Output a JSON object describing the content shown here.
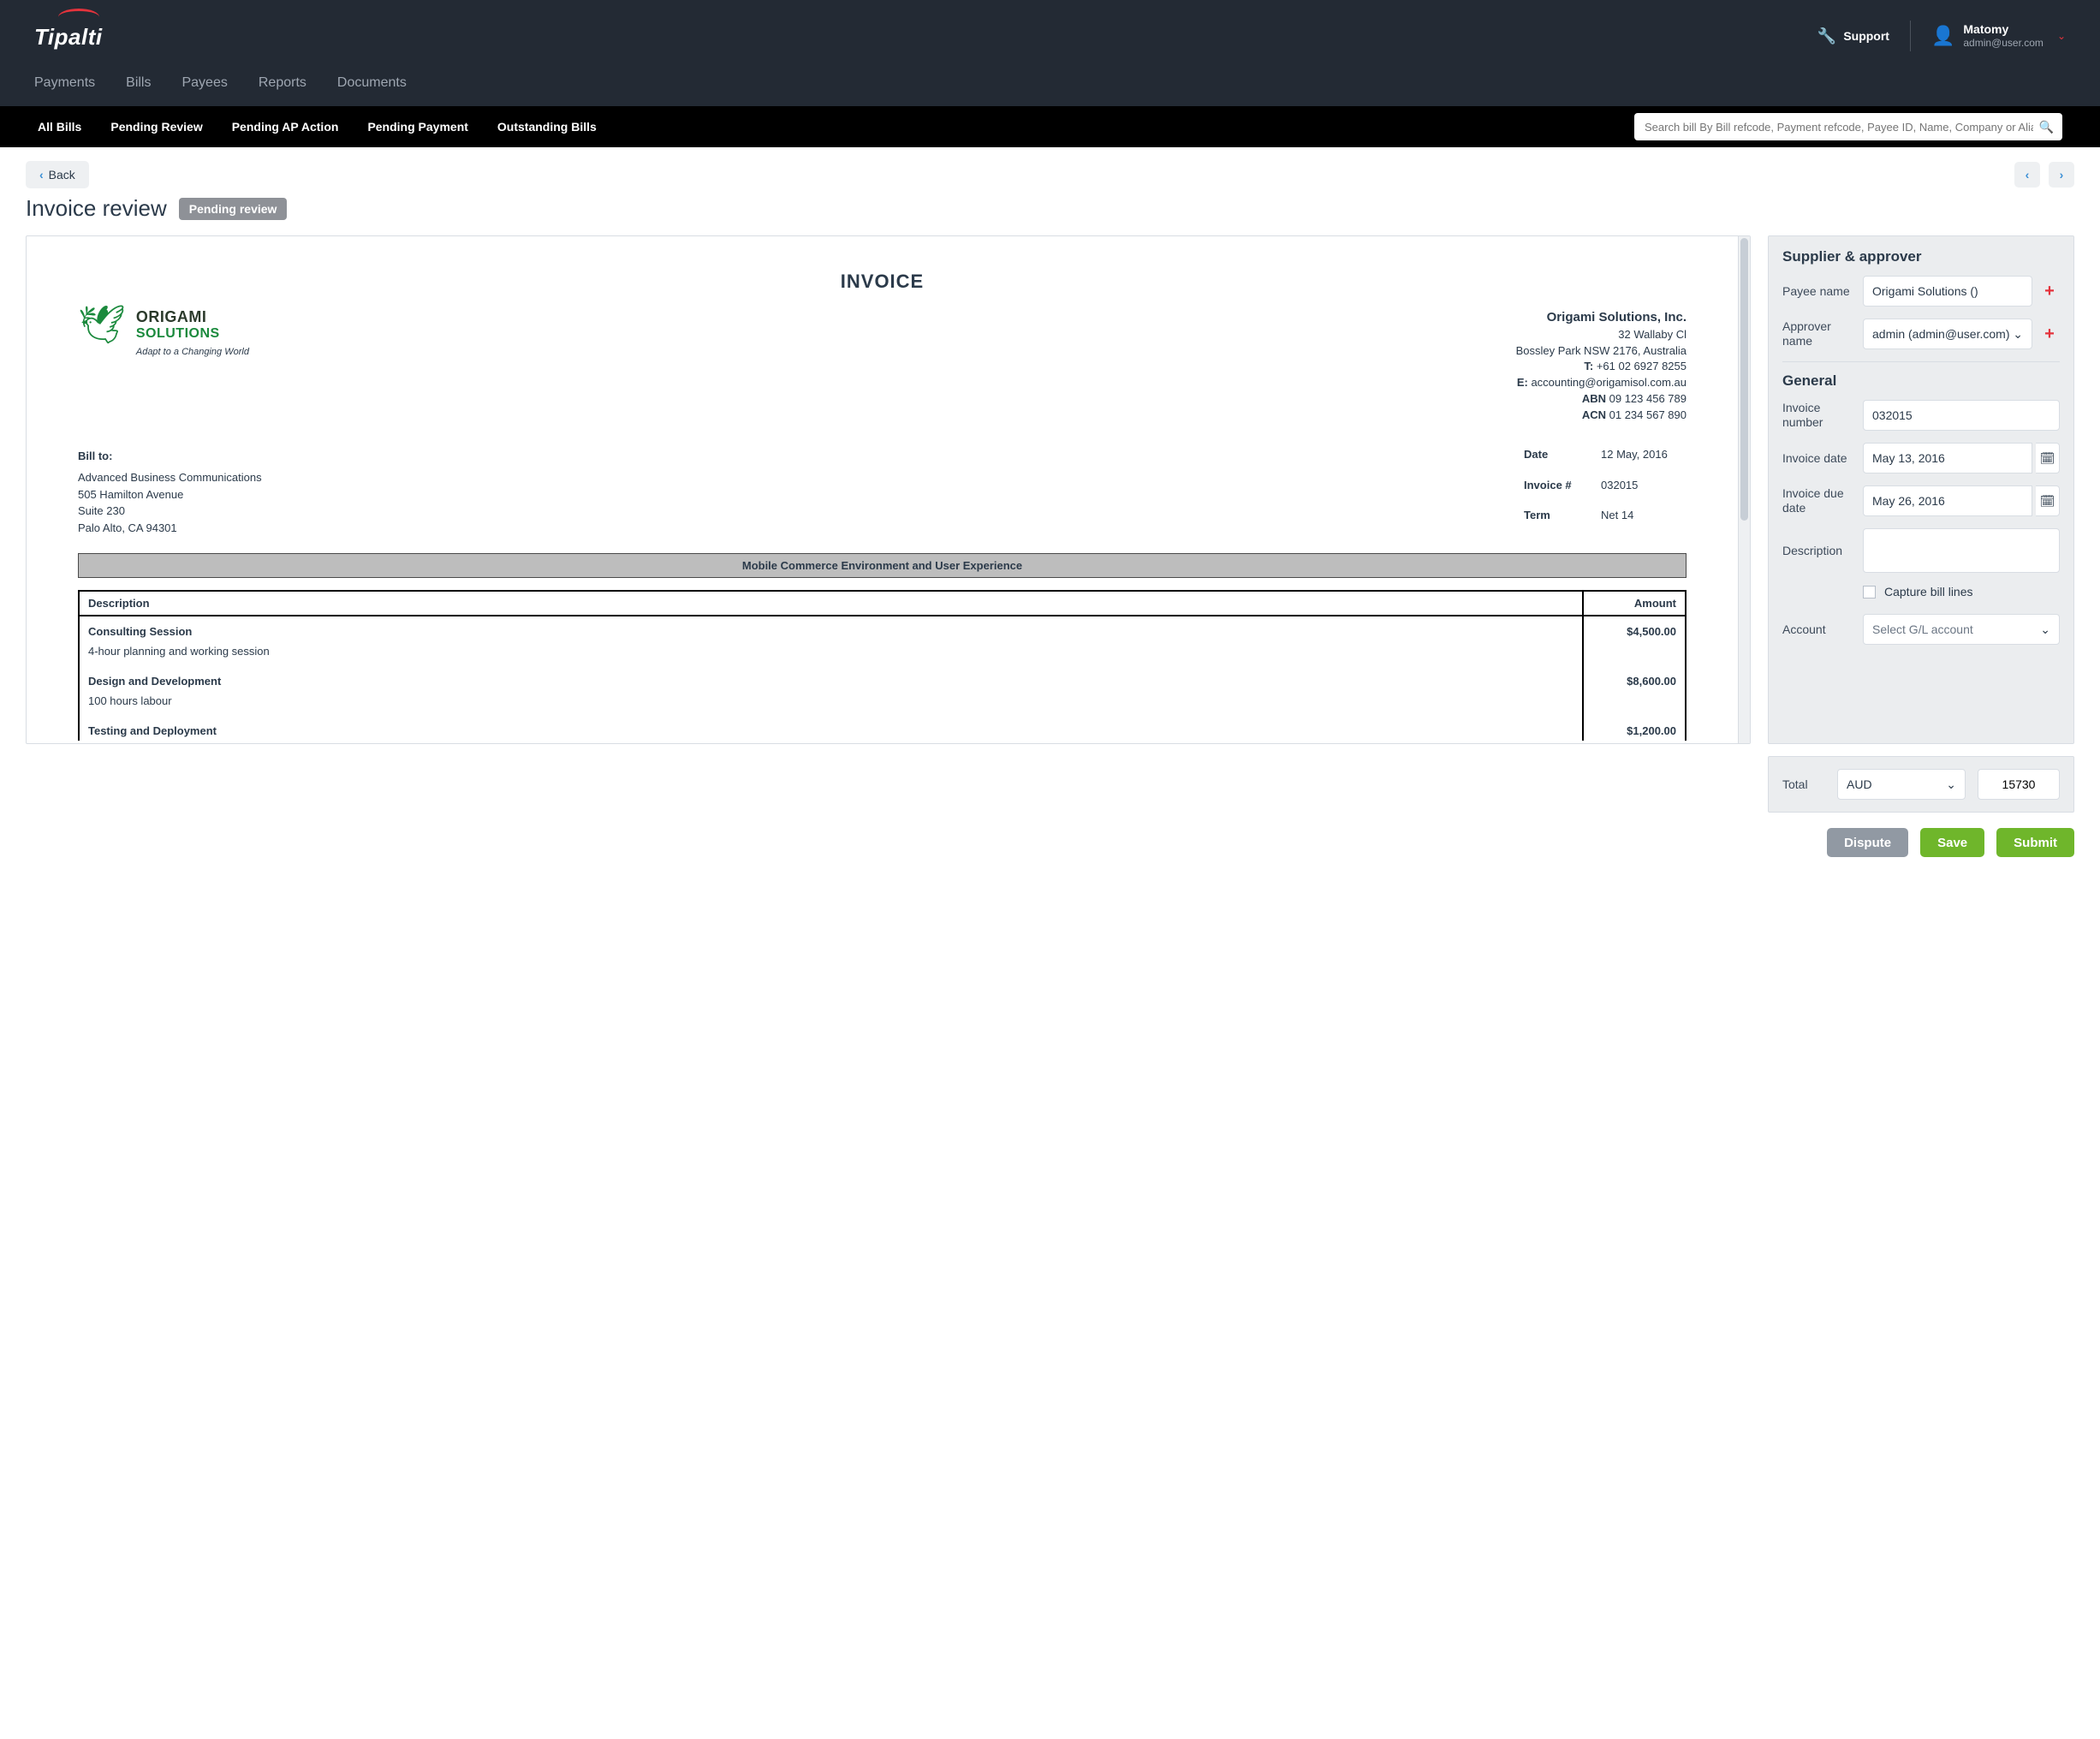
{
  "header": {
    "brand": "Tipalti",
    "support": "Support",
    "user_name": "Matomy",
    "user_email": "admin@user.com"
  },
  "nav1": [
    "Payments",
    "Bills",
    "Payees",
    "Reports",
    "Documents"
  ],
  "nav2": [
    "All Bills",
    "Pending Review",
    "Pending AP Action",
    "Pending Payment",
    "Outstanding Bills"
  ],
  "search_placeholder": "Search bill By Bill refcode, Payment refcode, Payee ID, Name, Company or Alias",
  "back": "Back",
  "page_title": "Invoice review",
  "status": "Pending review",
  "invoice_doc": {
    "title": "INVOICE",
    "company_upper": "ORIGAMI",
    "company_lower": "SOLUTIONS",
    "tagline": "Adapt to a Changing World",
    "company_full": "Origami Solutions, Inc.",
    "addr1": "32 Wallaby Cl",
    "addr2": "Bossley Park NSW 2176, Australia",
    "tel_label": "T:",
    "tel": "+61 02 6927 8255",
    "email_label": "E:",
    "email": "accounting@origamisol.com.au",
    "abn_label": "ABN",
    "abn": "09 123 456 789",
    "acn_label": "ACN",
    "acn": "01 234 567 890",
    "billto_label": "Bill to:",
    "billto": [
      "Advanced Business Communications",
      "505 Hamilton Avenue",
      "Suite 230",
      "Palo Alto, CA 94301"
    ],
    "meta": {
      "date_label": "Date",
      "date": "12 May, 2016",
      "num_label": "Invoice #",
      "num": "032015",
      "term_label": "Term",
      "term": "Net 14"
    },
    "project": "Mobile Commerce Environment and User Experience",
    "col_desc": "Description",
    "col_amt": "Amount",
    "items": [
      {
        "title": "Consulting Session",
        "sub": "4-hour planning and working session",
        "amount": "$4,500.00"
      },
      {
        "title": "Design and Development",
        "sub": "100 hours labour",
        "amount": "$8,600.00"
      },
      {
        "title": "Testing and Deployment",
        "sub": "",
        "amount": "$1,200.00"
      }
    ]
  },
  "side": {
    "sec1": "Supplier & approver",
    "payee_label": "Payee name",
    "payee_value": "Origami Solutions ()",
    "approver_label": "Approver name",
    "approver_value": "admin (admin@user.com)",
    "sec2": "General",
    "invnum_label": "Invoice number",
    "invnum_value": "032015",
    "invdate_label": "Invoice date",
    "invdate_value": "May 13, 2016",
    "invdue_label": "Invoice due date",
    "invdue_value": "May 26, 2016",
    "desc_label": "Description",
    "desc_value": "",
    "capture_label": "Capture bill lines",
    "account_label": "Account",
    "account_placeholder": "Select G/L account"
  },
  "total": {
    "label": "Total",
    "currency": "AUD",
    "amount": "15730"
  },
  "buttons": {
    "dispute": "Dispute",
    "save": "Save",
    "submit": "Submit"
  }
}
